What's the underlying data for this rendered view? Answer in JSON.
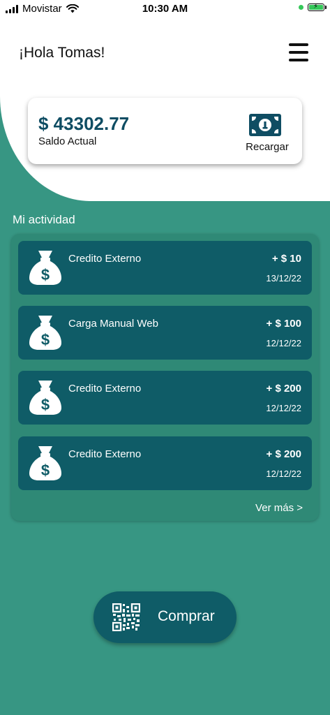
{
  "status_bar": {
    "carrier": "Movistar",
    "time": "10:30 AM",
    "icons": [
      "signal-icon",
      "wifi-icon",
      "battery-charging-icon"
    ]
  },
  "header": {
    "greeting": "¡Hola Tomas!",
    "menu_icon": "hamburger-menu-icon"
  },
  "balance_card": {
    "amount": "$ 43302.77",
    "label": "Saldo Actual",
    "recharge_label": "Recargar",
    "recharge_icon": "cash-icon"
  },
  "activity": {
    "title": "Mi actividad",
    "items": [
      {
        "title": "Credito Externo",
        "amount": "+ $ 10",
        "date": "13/12/22",
        "icon": "money-bag-icon"
      },
      {
        "title": "Carga Manual Web",
        "amount": "+ $ 100",
        "date": "12/12/22",
        "icon": "money-bag-icon"
      },
      {
        "title": "Credito Externo",
        "amount": "+ $ 200",
        "date": "12/12/22",
        "icon": "money-bag-icon"
      },
      {
        "title": "Credito Externo",
        "amount": "+ $ 200",
        "date": "12/12/22",
        "icon": "money-bag-icon"
      }
    ],
    "see_more": "Ver más >"
  },
  "buy_button": {
    "label": "Comprar",
    "icon": "qr-code-icon"
  },
  "colors": {
    "background_green": "#379683",
    "panel_green": "#2f8976",
    "item_teal": "#0f5c67",
    "amount_blue": "#0f4d63",
    "status_green": "#35c759"
  }
}
